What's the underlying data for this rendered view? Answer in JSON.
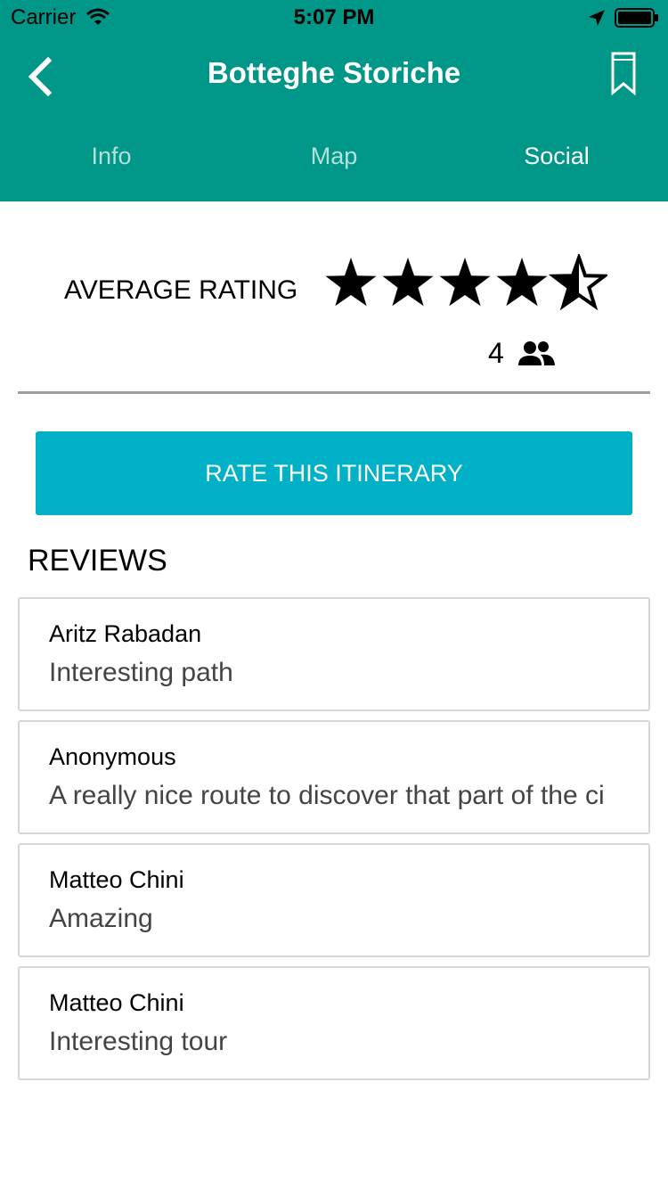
{
  "status_bar": {
    "carrier": "Carrier",
    "time": "5:07 PM",
    "icons": [
      "wifi-icon",
      "location-arrow-icon",
      "battery-icon"
    ]
  },
  "nav": {
    "title": "Botteghe Storiche",
    "back_icon": "chevron-left-icon",
    "bookmark_icon": "bookmark-icon"
  },
  "tabs": [
    {
      "label": "Info",
      "active": false
    },
    {
      "label": "Map",
      "active": false
    },
    {
      "label": "Social",
      "active": true
    }
  ],
  "rating": {
    "label": "AVERAGE RATING",
    "value": 4.5,
    "max": 5,
    "count": "4",
    "count_icon": "people-icon"
  },
  "rate_button": {
    "label": "RATE THIS ITINERARY"
  },
  "reviews": {
    "title": "REVIEWS",
    "items": [
      {
        "author": "Aritz Rabadan",
        "text": "Interesting path"
      },
      {
        "author": "Anonymous",
        "text": "A really nice route to discover that part of the ci"
      },
      {
        "author": "Matteo Chini",
        "text": "Amazing"
      },
      {
        "author": "Matteo Chini",
        "text": "Interesting tour"
      }
    ]
  },
  "colors": {
    "header": "#009688",
    "button": "#00b0c6",
    "divider": "#9e9e9e"
  }
}
